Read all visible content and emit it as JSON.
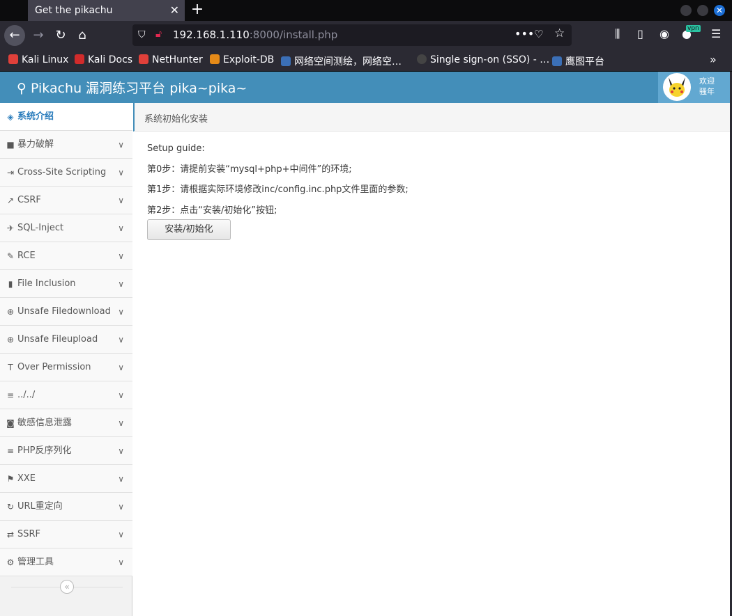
{
  "browser": {
    "tab_title": "Get the pikachu",
    "url_host": "192.168.1.110",
    "url_rest": ":8000/install.php",
    "vpn_badge": "vpn",
    "bookmarks": [
      {
        "label": "Kali Linux",
        "color": "#e0403a"
      },
      {
        "label": "Kali Docs",
        "color": "#d12b2b"
      },
      {
        "label": "NetHunter",
        "color": "#e0403a"
      },
      {
        "label": "Exploit-DB",
        "color": "#e58a18"
      },
      {
        "label": "网络空间测绘，网络空…",
        "color": "#3b6fb6"
      },
      {
        "label": "Single sign-on (SSO) - …",
        "color": "#444"
      },
      {
        "label": "鹰图平台",
        "color": "#3b6fb6"
      }
    ]
  },
  "header": {
    "brand": "Pikachu 漏洞练习平台 pika~pika~",
    "welcome_line1": "欢迎",
    "welcome_line2": "骚年"
  },
  "sidebar": {
    "items": [
      {
        "label": "系统介绍",
        "icon": "tags-icon"
      },
      {
        "label": "暴力破解",
        "icon": "lock-icon"
      },
      {
        "label": "Cross-Site Scripting",
        "icon": "indent-icon"
      },
      {
        "label": "CSRF",
        "icon": "share-icon"
      },
      {
        "label": "SQL-Inject",
        "icon": "plane-icon"
      },
      {
        "label": "RCE",
        "icon": "pencil-icon"
      },
      {
        "label": "File Inclusion",
        "icon": "file-icon"
      },
      {
        "label": "Unsafe Filedownload",
        "icon": "download-icon"
      },
      {
        "label": "Unsafe Fileupload",
        "icon": "upload-icon"
      },
      {
        "label": "Over Permission",
        "icon": "text-height-icon"
      },
      {
        "label": "../../",
        "icon": "align-left-icon"
      },
      {
        "label": "敏感信息泄露",
        "icon": "camera-icon"
      },
      {
        "label": "PHP反序列化",
        "icon": "align-left-icon"
      },
      {
        "label": "XXE",
        "icon": "flag-icon"
      },
      {
        "label": "URL重定向",
        "icon": "refresh-icon"
      },
      {
        "label": "SSRF",
        "icon": "exchange-icon"
      },
      {
        "label": "管理工具",
        "icon": "cog-icon"
      }
    ]
  },
  "main": {
    "breadcrumb": "系统初始化安装",
    "guide_title": "Setup guide:",
    "steps": [
      "第0步：请提前安装“mysql+php+中间件”的环境;",
      "第1步：请根据实际环境修改inc/config.inc.php文件里面的参数;",
      "第2步：点击“安装/初始化”按钮;"
    ],
    "install_button": "安装/初始化"
  }
}
